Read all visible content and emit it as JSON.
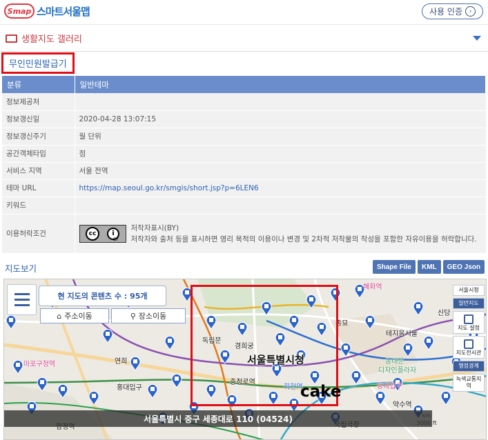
{
  "header": {
    "logo_badge": "Smap",
    "logo_text": "스마트서울맵",
    "auth_button": "사용 인증",
    "auth_chevron": "›"
  },
  "gallery": {
    "title": "생활지도 갤러리"
  },
  "theme": {
    "title": "무인민원발급기"
  },
  "info_table": {
    "header": [
      "분류",
      "일반테마"
    ],
    "rows": [
      {
        "key": "정보제공처",
        "value": ""
      },
      {
        "key": "정보갱신일",
        "value": "2020-04-28 13:07:15"
      },
      {
        "key": "정보갱신주기",
        "value": "월 단위"
      },
      {
        "key": "공간객체타입",
        "value": "점"
      },
      {
        "key": "서비스 지역",
        "value": "서울 전역"
      },
      {
        "key": "테마 URL",
        "value": "https://map.seoul.go.kr/smgis/short.jsp?p=6LEN6"
      },
      {
        "key": "키워드",
        "value": ""
      }
    ],
    "license": {
      "key": "이용허락조건",
      "cc_label": "BY",
      "line1": "저작자표시(BY)",
      "line2": "저작자와 출처 등을 표시하면 영리 목적의 이용이나 변경 및 2차적 저작물의 작성을 포함한 자유이용을 허락합니다."
    }
  },
  "map_section": {
    "label": "지도보기",
    "formats": [
      "Shape File",
      "KML",
      "GEO Json"
    ]
  },
  "map": {
    "count_text": "현 지도의 콘텐츠 수 : 95개",
    "address_move": "주소이동",
    "place_move": "장소이동",
    "address_bar": "서울특별시 중구 세종대로 110 (04524)",
    "scale_km": "1 km",
    "scale_ft": "5000 ft",
    "overlay_text": "cake",
    "city_hall": "서울특별시청",
    "labels": [
      {
        "text": "독립문",
        "cls": ""
      },
      {
        "text": "경희궁",
        "cls": ""
      },
      {
        "text": "충정로역",
        "cls": ""
      },
      {
        "text": "회현역",
        "cls": "blue"
      },
      {
        "text": "종묘",
        "cls": ""
      },
      {
        "text": "동대문",
        "cls": ""
      },
      {
        "text": "디자인플라자",
        "cls": "green"
      },
      {
        "text": "동대입구",
        "cls": "pink"
      },
      {
        "text": "약수역",
        "cls": ""
      },
      {
        "text": "홍대입구",
        "cls": ""
      },
      {
        "text": "연희",
        "cls": ""
      },
      {
        "text": "마포구청역",
        "cls": "pink"
      },
      {
        "text": "합정역",
        "cls": ""
      },
      {
        "text": "신당",
        "cls": ""
      },
      {
        "text": "혜화역",
        "cls": "pink"
      },
      {
        "text": "테지움서울",
        "cls": ""
      },
      {
        "text": "국립극장",
        "cls": ""
      }
    ],
    "side_panel": {
      "seoul_map": "서울시청",
      "general_map": "일반지도",
      "map_settings": "지도 설정",
      "map_exhibit": "지도전시관",
      "admin_boundary": "행정경계",
      "green_area": "녹색교통지역"
    }
  },
  "colors": {
    "accent_red": "#e00d14",
    "header_blue": "#6b8dcb",
    "link_blue": "#2e63b5",
    "marker_blue": "#2b63c9"
  }
}
